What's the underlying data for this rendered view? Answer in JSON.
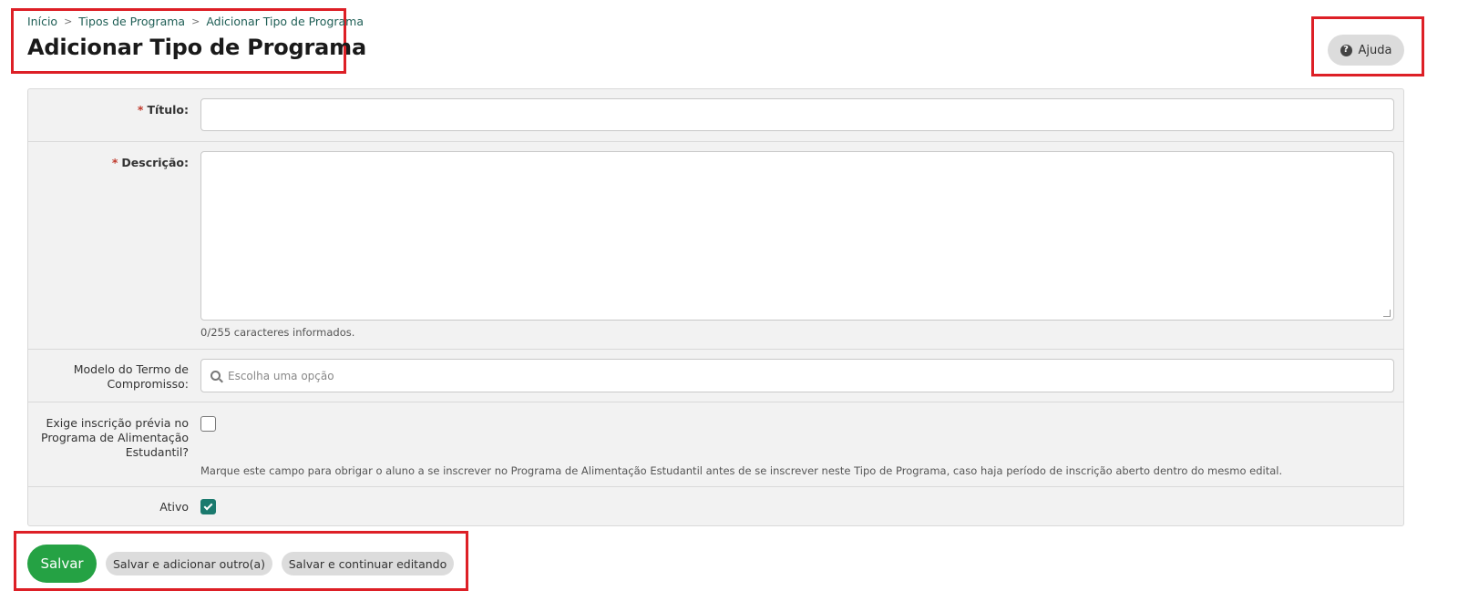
{
  "breadcrumb": {
    "items": [
      "Início",
      "Tipos de Programa",
      "Adicionar Tipo de Programa"
    ],
    "separator": ">"
  },
  "page_title": "Adicionar Tipo de Programa",
  "help_button": {
    "label": "Ajuda",
    "icon": "question-circle-icon"
  },
  "form": {
    "titulo": {
      "required_mark": "*",
      "label": "Título:",
      "value": ""
    },
    "descricao": {
      "required_mark": "*",
      "label": "Descrição:",
      "value": "",
      "counter": "0/255 caracteres informados."
    },
    "modelo_termo": {
      "label_line1": "Modelo do Termo de",
      "label_line2": "Compromisso:",
      "placeholder": "Escolha uma opção"
    },
    "exige_inscricao": {
      "label_line1": "Exige inscrição prévia no",
      "label_line2": "Programa de Alimentação",
      "label_line3": "Estudantil?",
      "checked": false,
      "help": "Marque este campo para obrigar o aluno a se inscrever no Programa de Alimentação Estudantil antes de se inscrever neste Tipo de Programa, caso haja período de inscrição aberto dentro do mesmo edital."
    },
    "ativo": {
      "label": "Ativo",
      "checked": true
    }
  },
  "actions": {
    "save": "Salvar",
    "save_add_another": "Salvar e adicionar outro(a)",
    "save_continue": "Salvar e continuar editando"
  },
  "colors": {
    "highlight": "#dd1f26",
    "primary": "#25a244",
    "checkbox_checked": "#1b7a6e",
    "breadcrumb_link": "#1e5e55"
  }
}
